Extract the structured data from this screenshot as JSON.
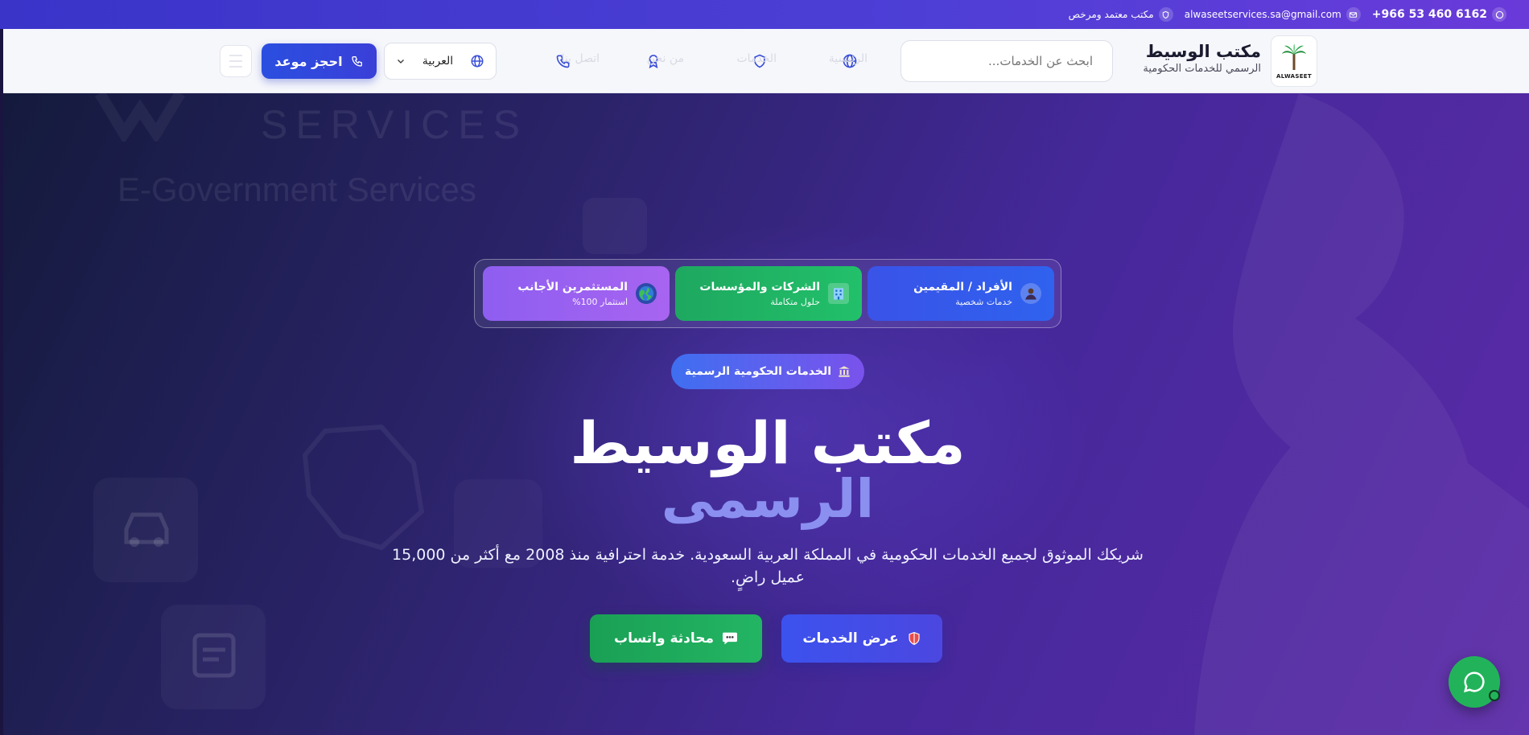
{
  "topbar": {
    "phone": "+966 53 460 6162",
    "email": "alwaseetservices.sa@gmail.com",
    "license": "مكتب معتمد ومرخص",
    "phone_icon": "whatsapp-icon",
    "email_icon": "mail-icon",
    "license_icon": "shield-icon"
  },
  "header": {
    "logo_text": "ALWASEET",
    "brand_name": "مكتب الوسيط",
    "brand_sub": "الرسمي للخدمات الحكومية",
    "search_placeholder": "ابحث عن الخدمات...",
    "nav": [
      {
        "label": "الرئيسية",
        "icon": "globe-icon"
      },
      {
        "label": "الخدمات",
        "icon": "shield-icon"
      },
      {
        "label": "من نحن",
        "icon": "award-icon"
      },
      {
        "label": "اتصل بنا",
        "icon": "phone-icon"
      }
    ],
    "language": "العربية",
    "book_label": "احجز موعد"
  },
  "hero": {
    "watermark_services": "SERVICES",
    "watermark_egov": "E-Government Services",
    "audiences": [
      {
        "title": "الأفراد / المقيمين",
        "subtitle": "خدمات شخصية",
        "icon": "person-icon"
      },
      {
        "title": "الشركات والمؤسسات",
        "subtitle": "حلول متكاملة",
        "icon": "building-icon"
      },
      {
        "title": "المستثمرين الأجانب",
        "subtitle": "استثمار 100%",
        "icon": "globe-icon"
      }
    ],
    "badge": "الخدمات الحكومية الرسمية",
    "title_line1": "مكتب الوسيط",
    "title_line2": "الرسمى",
    "description": "شريكك الموثوق لجميع الخدمات الحكومية في المملكة العربية السعودية. خدمة احترافية منذ 2008 مع أكثر من 15,000 عميل راضٍ.",
    "btn_services": "عرض الخدمات",
    "btn_whatsapp": "محادثة واتساب"
  },
  "colors": {
    "primary_blue": "#2f56e6",
    "green": "#22b35a",
    "purple": "#9a62f0",
    "accent_title": "#8a8ff0"
  }
}
